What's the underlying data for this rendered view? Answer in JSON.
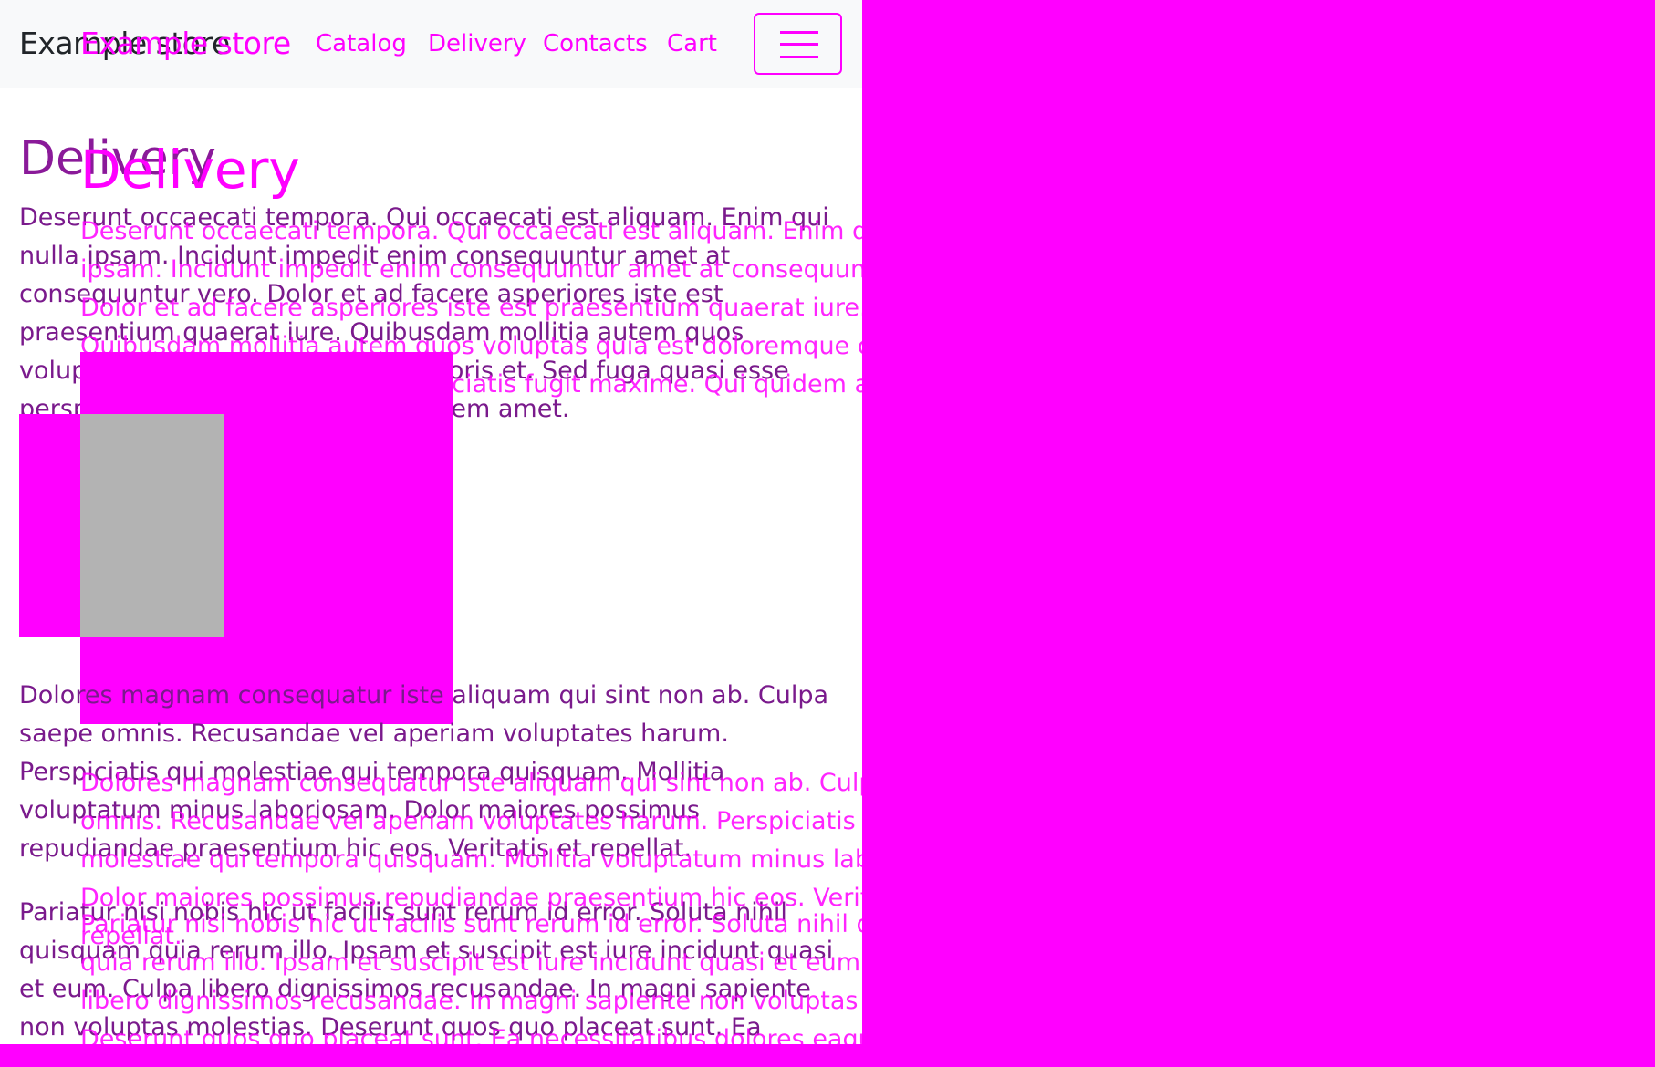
{
  "navbar": {
    "brand": "Example store",
    "links": [
      "Catalog",
      "Delivery",
      "Contacts",
      "Cart"
    ]
  },
  "page": {
    "title": "Delivery",
    "paragraphs": [
      "Deserunt occaecati tempora. Qui occaecati est aliquam. Enim qui nulla ipsam. Incidunt impedit enim consequuntur amet at consequuntur vero. Dolor et ad facere asperiores iste est praesentium quaerat iure. Quibusdam mollitia autem quos voluptas quia est doloremque corporis et. Sed fuga quasi esse perspiciatis fugit maxime. Qui quidem amet.",
      "Dolores magnam consequatur iste aliquam qui sint non ab. Culpa saepe omnis. Recusandae vel aperiam voluptates harum. Perspiciatis qui molestiae qui tempora quisquam. Mollitia voluptatum minus laboriosam. Dolor maiores possimus repudiandae praesentium hic eos. Veritatis et repellat.",
      "Pariatur nisi nobis hic ut facilis sunt rerum id error. Soluta nihil quisquam quia rerum illo. Ipsam et suscipit est iure incidunt quasi et eum. Culpa libero dignissimos recusandae. In magni sapiente non voluptas molestias. Deserunt quos quo placeat sunt. Ea necessitatibus dolores eaque ex"
    ]
  },
  "colors": {
    "highlight": "#ff00ff",
    "navbar_bg": "#f8f9fa",
    "placeholder": "#b3b3b3"
  },
  "icons": {
    "toggler": "hamburger-menu-icon"
  }
}
